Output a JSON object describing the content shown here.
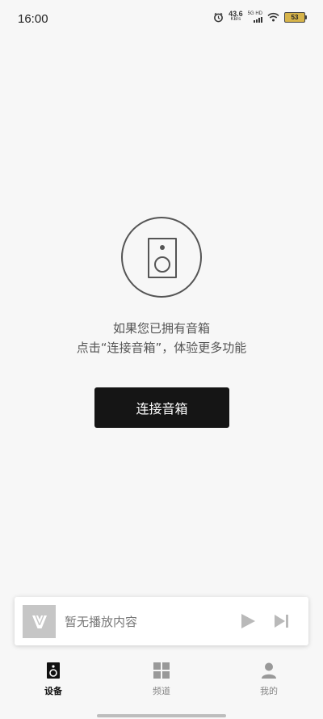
{
  "status_bar": {
    "time": "16:00",
    "net_speed_value": "43.6",
    "net_speed_unit": "KB/s",
    "network_type": "5G HD",
    "battery_level": "53",
    "icons": [
      "alarm-icon",
      "signal-icon",
      "wifi-icon",
      "battery-icon"
    ]
  },
  "empty_state": {
    "icon": "speaker-icon",
    "line1": "如果您已拥有音箱",
    "line2": "点击“连接音箱”，体验更多功能",
    "button_label": "连接音箱"
  },
  "mini_player": {
    "title": "暂无播放内容",
    "icons": [
      "cover-placeholder-icon",
      "play-icon",
      "skip-next-icon"
    ]
  },
  "tabs": [
    {
      "label": "设备",
      "icon": "speaker-tab-icon",
      "active": true
    },
    {
      "label": "频道",
      "icon": "grid-icon",
      "active": false
    },
    {
      "label": "我的",
      "icon": "person-icon",
      "active": false
    }
  ],
  "colors": {
    "background": "#f7f7f7",
    "primary_button": "#151515",
    "battery": "#d7b44a",
    "inactive_tab": "#888888"
  }
}
